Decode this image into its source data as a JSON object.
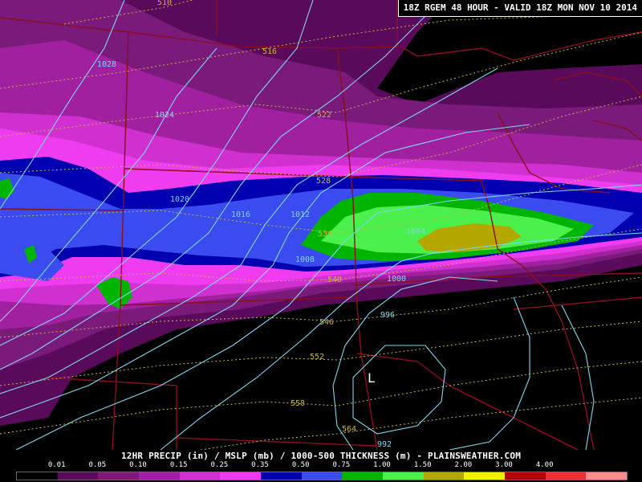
{
  "header": {
    "title": "18Z RGEM 48 HOUR - VALID 18Z MON NOV 10 2014"
  },
  "footer": {
    "title": "12HR PRECIP (in) / MSLP (mb) / 1000-500 THICKNESS (m) - PLAINSWEATHER.COM"
  },
  "legend": {
    "labels": [
      "0.01",
      "0.05",
      "0.10",
      "0.15",
      "0.25",
      "0.35",
      "0.50",
      "0.75",
      "1.00",
      "1.50",
      "2.00",
      "3.00",
      "4.00"
    ],
    "colors": [
      "#000000",
      "#5a0a5a",
      "#7a1a7a",
      "#a020a0",
      "#d030d0",
      "#f03cf0",
      "#0000b0",
      "#3a4cf0",
      "#00b400",
      "#4cf04c",
      "#b4a800",
      "#f0f000",
      "#b40000",
      "#f03030",
      "#ff8c8c"
    ]
  },
  "mslp_labels": [
    "1028",
    "1024",
    "1020",
    "1016",
    "1012",
    "1008",
    "1004",
    "1000",
    "996",
    "992"
  ],
  "thickness_labels": [
    "510",
    "516",
    "522",
    "528",
    "534",
    "540",
    "546",
    "552",
    "558",
    "564"
  ],
  "low_marker": "L",
  "colors": {
    "isobar": "#7fd7f0",
    "thickness": "#c8b43c",
    "border": "#8b0d1e",
    "precip_0.05": "#5a0a5a",
    "precip_0.10": "#7a1a7a",
    "precip_0.15": "#a020a0",
    "precip_0.25": "#d030d0",
    "precip_0.35": "#f03cf0",
    "precip_0.50": "#0000b0",
    "precip_0.75": "#3a4cf0",
    "precip_1.00": "#00b400",
    "precip_1.50": "#4cf04c",
    "precip_2.00": "#b4a800"
  }
}
